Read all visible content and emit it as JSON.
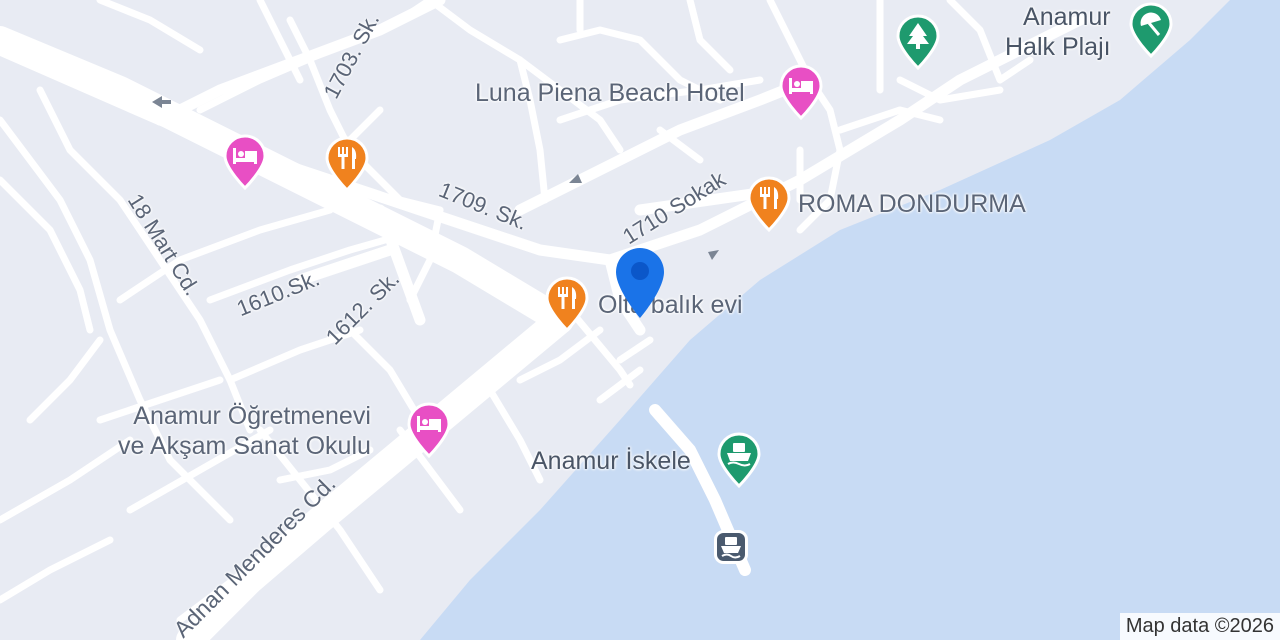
{
  "map": {
    "streets": [
      {
        "id": "s1703",
        "label": "1703. Sk."
      },
      {
        "id": "s1709",
        "label": "1709. Sk."
      },
      {
        "id": "s1710",
        "label": "1710 Sokak"
      },
      {
        "id": "s18mart",
        "label": "18 Mart Cd."
      },
      {
        "id": "s1610",
        "label": "1610.Sk."
      },
      {
        "id": "s1612",
        "label": "1612. Sk."
      },
      {
        "id": "adnan",
        "label": "Adnan Menderes Cd."
      }
    ],
    "pois": [
      {
        "id": "halk-plaji",
        "label_line1": "Anamur",
        "label_line2": "Halk Plajı",
        "icon": "beach-umbrella-icon",
        "color": "#1e9a6e"
      },
      {
        "id": "park",
        "icon": "tree-icon",
        "color": "#1e9a6e"
      },
      {
        "id": "luna-piena",
        "label": "Luna Piena Beach Hotel",
        "icon": "bed-icon",
        "color": "#e84fc4"
      },
      {
        "id": "hotel-west",
        "icon": "bed-icon",
        "color": "#e84fc4"
      },
      {
        "id": "restaurant-north",
        "icon": "fork-knife-icon",
        "color": "#f0821e"
      },
      {
        "id": "roma",
        "label": "ROMA DONDURMA",
        "icon": "fork-knife-icon",
        "color": "#f0821e"
      },
      {
        "id": "olta",
        "label": "Olta balık evi",
        "icon": "fork-knife-icon",
        "color": "#f0821e"
      },
      {
        "id": "ogretmenevi",
        "label_line1": "Anamur Öğretmenevi",
        "label_line2": "ve Akşam Sanat Okulu",
        "icon": "bed-icon",
        "color": "#e84fc4"
      },
      {
        "id": "iskele",
        "label": "Anamur İskele",
        "icon": "ferry-icon",
        "color": "#1e9a6e"
      },
      {
        "id": "ferry-terminal",
        "icon": "ferry-icon",
        "color": "#4a5a6e"
      }
    ],
    "location_pin": {
      "icon": "location-pin-icon",
      "color": "#1a73e8"
    },
    "attribution": "Map data ©2026"
  }
}
